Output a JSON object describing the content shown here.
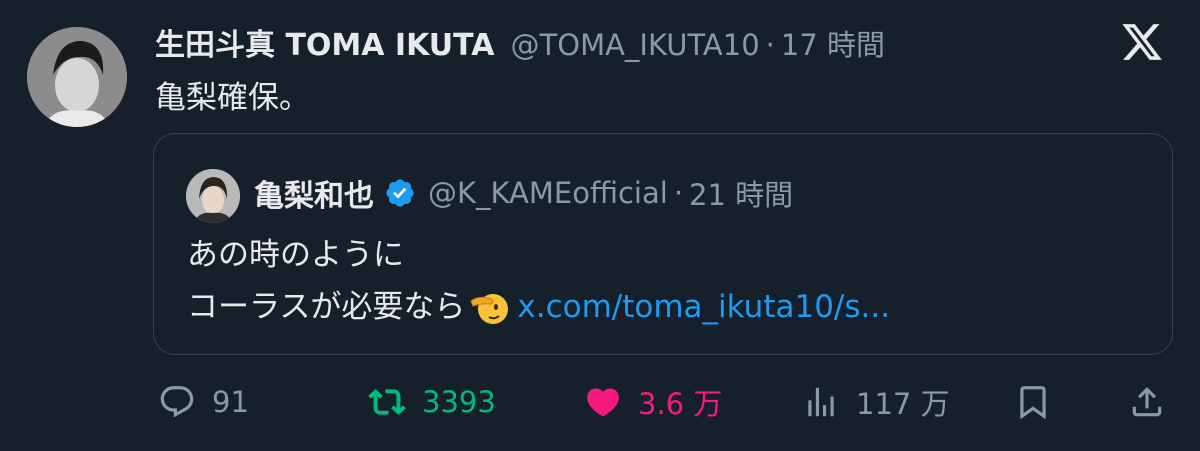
{
  "tweet": {
    "display_name": "生田斗真 TOMA IKUTA",
    "handle": "@TOMA_IKUTA10",
    "separator": "·",
    "time": "17 時間",
    "text": "亀梨確保。",
    "avatar_icon": "user-avatar"
  },
  "quoted_tweet": {
    "display_name": "亀梨和也",
    "verified": true,
    "handle": "@K_KAMEofficial",
    "separator": "·",
    "time": "21 時間",
    "line1": "あの時のように",
    "line2": "コーラスが必要なら",
    "emoji": "saluting-face",
    "link": "x.com/toma_ikuta10/s..."
  },
  "actions": {
    "replies": "91",
    "retweets": "3393",
    "likes": "3.6 万",
    "views": "117 万"
  },
  "colors": {
    "background": "#15202b",
    "text": "#e7e9ea",
    "secondary": "#8b98a5",
    "link": "#1d9bf0",
    "retweet": "#00ba7c",
    "like": "#f91880",
    "verified": "#1d9bf0"
  }
}
